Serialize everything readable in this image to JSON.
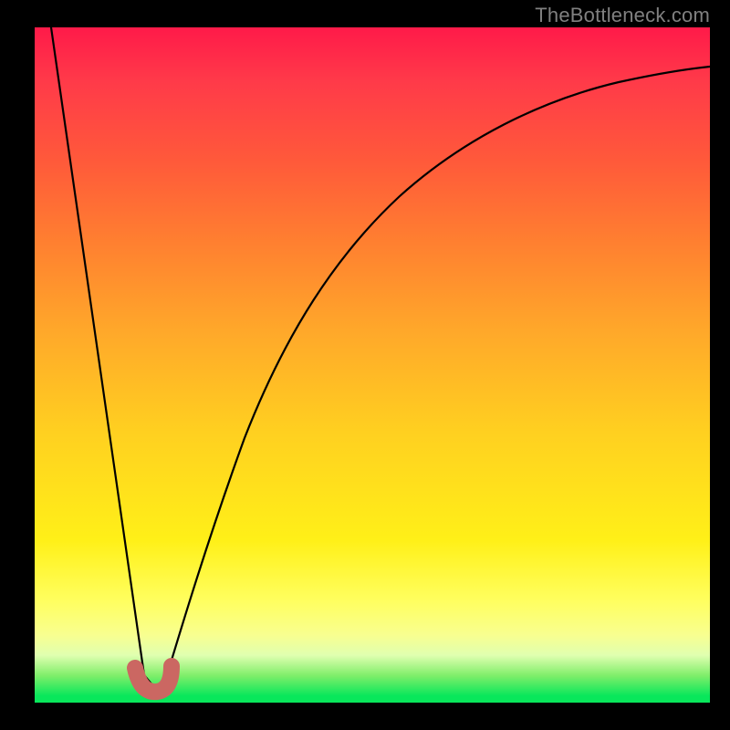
{
  "watermark": "TheBottleneck.com",
  "chart_data": {
    "type": "line",
    "title": "",
    "xlabel": "",
    "ylabel": "",
    "xlim": [
      0,
      100
    ],
    "ylim": [
      0,
      100
    ],
    "series": [
      {
        "name": "bottleneck-curve",
        "x": [
          0,
          5,
          10,
          13,
          15,
          16,
          17,
          19,
          22,
          26,
          32,
          40,
          50,
          62,
          76,
          88,
          100
        ],
        "y": [
          100,
          72,
          38,
          14,
          3,
          1,
          2,
          7,
          20,
          35,
          52,
          67,
          78,
          86,
          91,
          93,
          94
        ]
      }
    ],
    "annotations": [
      {
        "name": "optimal-marker",
        "x": 16.2,
        "y": 1.5
      }
    ],
    "gradient_stops": [
      {
        "pos": 0,
        "color": "#ff1a49"
      },
      {
        "pos": 45,
        "color": "#ffa82a"
      },
      {
        "pos": 85,
        "color": "#ffff60"
      },
      {
        "pos": 100,
        "color": "#09e75b"
      }
    ]
  }
}
